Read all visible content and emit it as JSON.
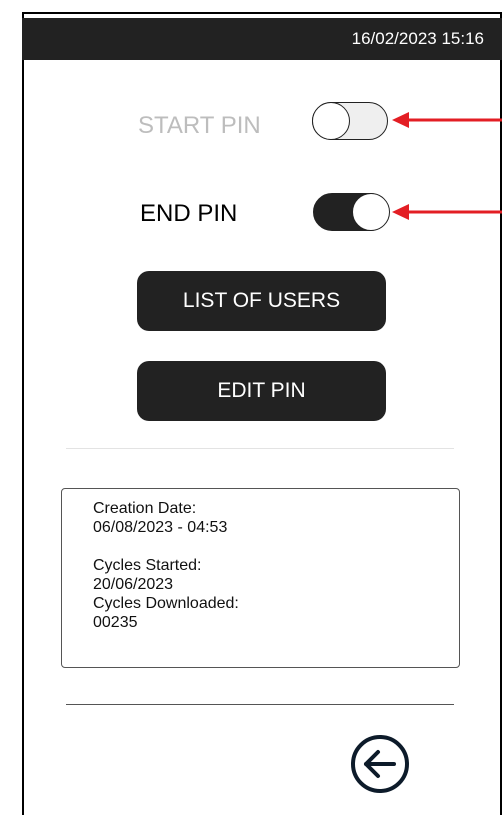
{
  "header": {
    "datetime": "16/02/2023 15:16"
  },
  "pins": {
    "start_label": "START PIN",
    "start_enabled": false,
    "end_label": "END PIN",
    "end_enabled": true
  },
  "buttons": {
    "list_users": "LIST OF USERS",
    "edit_pin": "EDIT PIN"
  },
  "info": {
    "creation_date_label": "Creation Date:",
    "creation_date_value": "06/08/2023 - 04:53",
    "cycles_started_label": "Cycles Started:",
    "cycles_started_value": "20/06/2023",
    "cycles_downloaded_label": "Cycles Downloaded:",
    "cycles_downloaded_value": "00235"
  },
  "icons": {
    "back": "arrow-left-circle-icon",
    "annotation_arrow": "red-arrow-icon"
  },
  "colors": {
    "bar": "#222222",
    "annotation": "#e31e24",
    "disabled_text": "#bdbdbd"
  }
}
